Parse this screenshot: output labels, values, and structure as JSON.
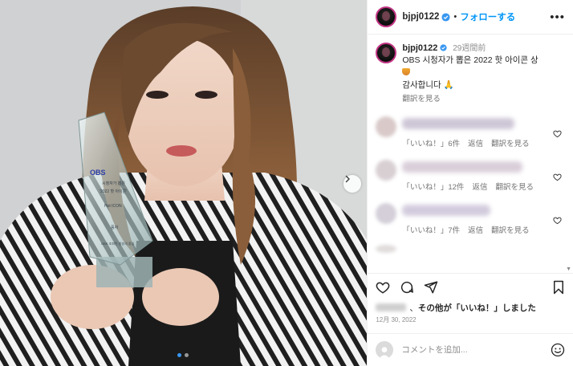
{
  "post": {
    "username": "bjpj0122",
    "separator": "•",
    "follow_label": "フォローする",
    "more_label": "•••",
    "caption": {
      "time_ago": "29週間前",
      "line1": "OBS 시청자가 뽑은 2022 핫 아이콘 상",
      "line3": "감사합니다 🙏",
      "translate_label": "翻訳を見る"
    },
    "comments": [
      {
        "likes": "「いいね！」6件",
        "reply": "返信",
        "translate": "翻訳を見る",
        "blur_color": "#c9c3d9"
      },
      {
        "likes": "「いいね！」12件",
        "reply": "返信",
        "translate": "翻訳を見る",
        "blur_color": "#d7cdd8"
      },
      {
        "likes": "「いいね！」7件",
        "reply": "返信",
        "translate": "翻訳を見る",
        "blur_color": "#cfc8dc"
      }
    ],
    "likes_text": "その他が「いいね！」しました",
    "likes_prefix": "、",
    "date": "12月 30, 2022",
    "comment_placeholder": "コメントを追加...",
    "trophy_text": {
      "brand": "OBS",
      "line1": "시청자가 뽑은",
      "line2": "'2022 핫 아이콘'",
      "line3": "Hot ICON",
      "line4": "풍자",
      "line5": "OBS 조회인 방송의 중심"
    }
  },
  "colors": {
    "accent": "#0095f6",
    "verified": "#3897f0",
    "carousel_dot_active": "#3897f0"
  },
  "carousel": {
    "count": 2,
    "active": 1
  }
}
